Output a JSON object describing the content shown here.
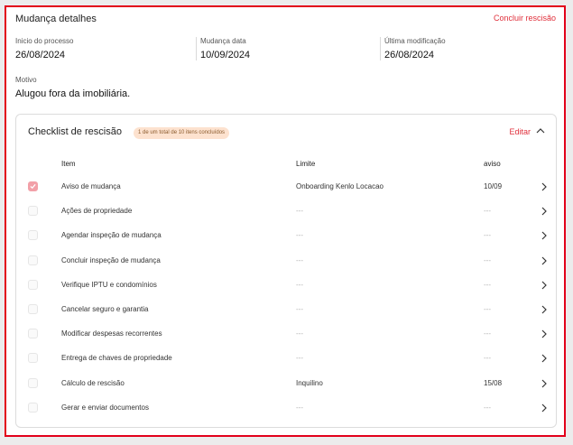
{
  "header": {
    "title": "Mudança detalhes",
    "action_label": "Concluir rescisão"
  },
  "meta": [
    {
      "label": "Inicio do processo",
      "value": "26/08/2024"
    },
    {
      "label": "Mudança data",
      "value": "10/09/2024"
    },
    {
      "label": "Última modificação",
      "value": "26/08/2024"
    }
  ],
  "motivo": {
    "label": "Motivo",
    "value": "Alugou fora da imobiliária."
  },
  "checklist": {
    "title": "Checklist de rescisão",
    "badge": "1 de um total de 10 itens concluídos",
    "edit_label": "Editar",
    "columns": {
      "item": "Item",
      "limite": "Limite",
      "aviso": "aviso"
    },
    "rows": [
      {
        "item": "Aviso de mudança",
        "limite": "Onboarding Kenlo Locacao",
        "aviso": "10/09",
        "checked": true
      },
      {
        "item": "Ações de propriedade",
        "limite": "---",
        "aviso": "---",
        "checked": false
      },
      {
        "item": "Agendar inspeção de mudança",
        "limite": "---",
        "aviso": "---",
        "checked": false
      },
      {
        "item": "Concluir inspeção de mudança",
        "limite": "---",
        "aviso": "---",
        "checked": false
      },
      {
        "item": "Verifique IPTU e condomínios",
        "limite": "---",
        "aviso": "---",
        "checked": false
      },
      {
        "item": "Cancelar seguro e garantia",
        "limite": "---",
        "aviso": "---",
        "checked": false
      },
      {
        "item": "Modificar despesas recorrentes",
        "limite": "---",
        "aviso": "---",
        "checked": false
      },
      {
        "item": "Entrega de chaves de propriedade",
        "limite": "---",
        "aviso": "---",
        "checked": false
      },
      {
        "item": "Cálculo de rescisão",
        "limite": "Inquilino",
        "aviso": "15/08",
        "checked": false
      },
      {
        "item": "Gerar e enviar documentos",
        "limite": "---",
        "aviso": "---",
        "checked": false
      }
    ]
  },
  "colors": {
    "accent": "#e0303c",
    "frame": "#e2001a",
    "checked": "#f2a0a8",
    "badge_bg": "#fde2cf"
  },
  "icons": {
    "collapse": "chevron-up-icon",
    "row_action": "chevron-right-icon",
    "check": "check-icon"
  }
}
